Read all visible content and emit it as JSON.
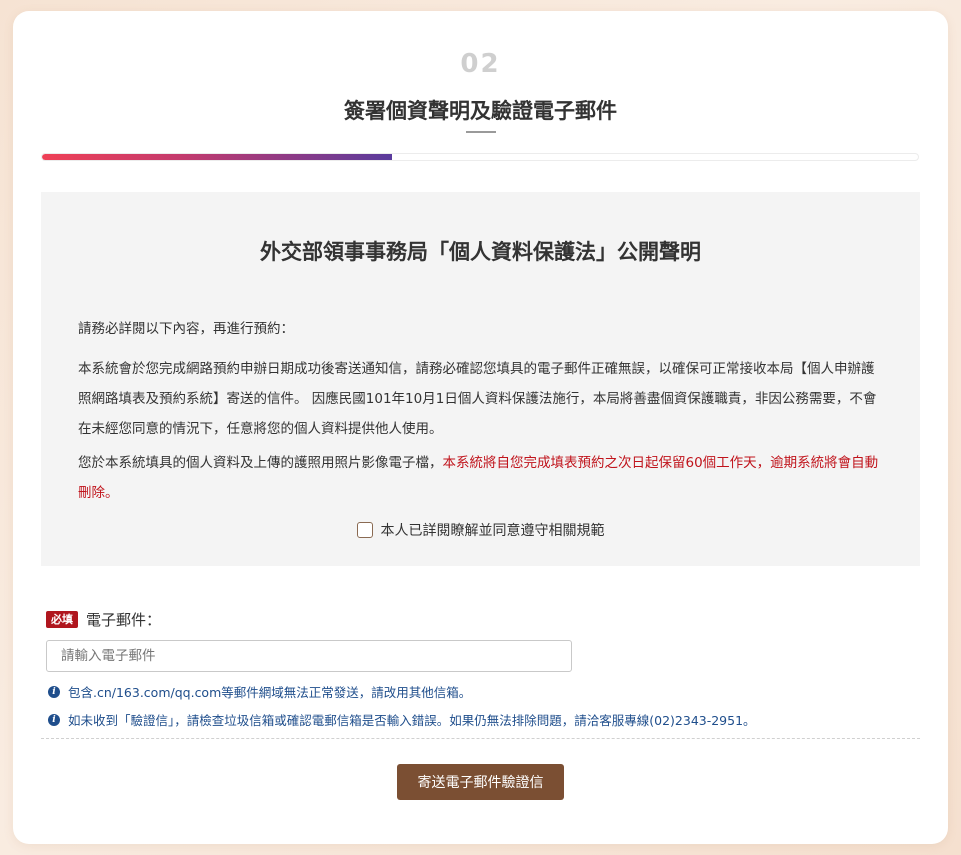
{
  "step": {
    "number": "02",
    "title": "簽署個資聲明及驗證電子郵件",
    "progress": 0.4
  },
  "notice": {
    "title": "外交部領事事務局「個人資料保護法」公開聲明",
    "intro": "請務必詳閱以下內容，再進行預約：",
    "paragraph2": "本系統會於您完成網路預約申辦日期成功後寄送通知信，請務必確認您填具的電子郵件正確無誤，以確保可正常接收本局【個人申辦護照網路填表及預約系統】寄送的信件。 因應民國101年10月1日個人資料保護法施行，本局將善盡個資保護職責，非因公務需要，不會在未經您同意的情況下，任意將您的個人資料提供他人使用。",
    "paragraph3_normal": "您於本系統填具的個人資料及上傳的護照用照片影像電子檔，",
    "paragraph3_red": "本系統將自您完成填表預約之次日起保留60個工作天，逾期系統將會自動刪除。",
    "agree_label": "本人已詳閱瞭解並同意遵守相關規範",
    "agree_checked": false
  },
  "email": {
    "required_badge": "必填",
    "label": "電子郵件：",
    "value": "",
    "placeholder": "請輸入電子郵件"
  },
  "info": [
    "包含.cn/163.com/qq.com等郵件網域無法正常發送，請改用其他信箱。",
    "如未收到「驗證信」，請檢查垃圾信箱或確認電郵信箱是否輸入錯誤。如果仍無法排除問題，請洽客服專線(02)2343-2951。"
  ],
  "actions": {
    "send_label": "寄送電子郵件驗證信"
  },
  "colors": {
    "progress_start": "#ef4056",
    "progress_end": "#5a3b9d",
    "button": "#7b4f33",
    "required_badge": "#b0161e",
    "warning_text": "#c0131b",
    "info_text": "#1f4e8c"
  }
}
